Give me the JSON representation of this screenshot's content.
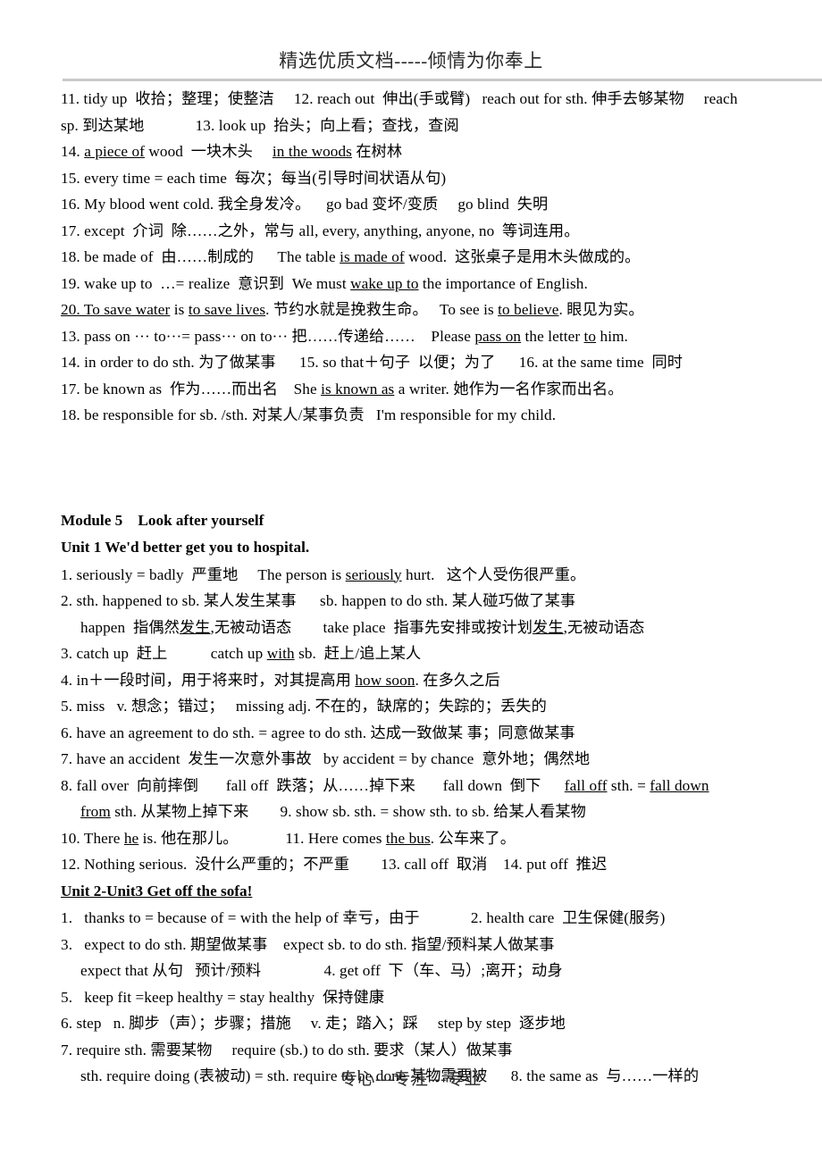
{
  "document": {
    "header_text": "精选优质文档-----倾情为你奉上",
    "footer_text": "专心---专注---专业"
  },
  "section_one": {
    "lines": [
      "11. tidy up  收拾；整理；使整洁     12. reach out  伸出(手或臂)   reach out for sth. 伸手去够某物     reach",
      "sp. 到达某地             13. look up  抬头；向上看；查找，查阅"
    ],
    "line14": {
      "prefix": "14. ",
      "u1": "a piece of",
      "mid1": " wood  一块木头     ",
      "u2": "in the woods",
      "suffix": " 在树林"
    },
    "line15": "15. every time = each time  每次；每当(引导时间状语从句)",
    "line16": "16. My blood went cold. 我全身发冷。    go bad 变坏/变质     go blind  失明",
    "line17": "17. except  介词  除……之外，常与 all, every, anything, anyone, no  等词连用。",
    "line18": {
      "prefix": "18. be made of  由……制成的      The table ",
      "u1": "is made of",
      "suffix": " wood.  这张桌子是用木头做成的。"
    },
    "line19": {
      "prefix": "19. wake up to  …= realize  意识到  We must ",
      "u1": "wake up to",
      "suffix": " the importance of English."
    },
    "line20": {
      "u1": "20. To save water",
      "mid1": " is ",
      "u2": "to save lives",
      "mid2": ". 节约水就是挽救生命。   To see is ",
      "u3": "to believe",
      "suffix": ". 眼见为实。"
    },
    "line13b": {
      "prefix": "13. pass on ··· to···= pass··· on to··· 把……传递给……    Please ",
      "u1": "pass on",
      "mid1": " the letter ",
      "u2": "to",
      "suffix": " him."
    },
    "line14b": "14. in order to do sth. 为了做某事      15. so that＋句子  以便；为了      16. at the same time  同时",
    "line17b": {
      "prefix": "17. be known as  作为……而出名    She ",
      "u1": "is known as",
      "suffix": " a writer. 她作为一名作家而出名。"
    },
    "line18b": "18. be responsible for sb. /sth. 对某人/某事负责   I'm responsible for my child."
  },
  "module5": {
    "title": "Module 5    Look after yourself",
    "unit1_title": "Unit 1 We'd better get you to hospital.",
    "line1": {
      "prefix": "1. seriously = badly  严重地     The person is ",
      "u1": "seriously",
      "suffix": " hurt.   这个人受伤很严重。"
    },
    "line2": "2. sth. happened to sb. 某人发生某事      sb. happen to do sth. 某人碰巧做了某事",
    "line2b": {
      "prefix": "happen  指偶然",
      "u1": "发生",
      "mid1": ",无被动语态        take place  指事先安排或按计划",
      "u2": "发生",
      "suffix": ",无被动语态"
    },
    "line3": {
      "prefix": "3. catch up  赶上           catch up ",
      "u1": "with",
      "suffix": " sb.  赶上/追上某人"
    },
    "line4": {
      "prefix": "4. in＋一段时间，用于将来时，对其提高用 ",
      "u1": "how soon",
      "suffix": ". 在多久之后"
    },
    "line5": "5. miss   v. 想念；错过；   missing adj. 不在的，缺席的；失踪的；丢失的",
    "line6": "6. have an agreement to do sth. = agree to do sth. 达成一致做某 事；同意做某事",
    "line7": "7. have an accident  发生一次意外事故   by accident = by chance  意外地；偶然地",
    "line8": {
      "prefix": "8. fall over  向前摔倒       fall off  跌落；从……掉下来       fall down  倒下      ",
      "u1": "fall off",
      "mid1": " sth. = ",
      "u2": "fall down"
    },
    "line8b": {
      "u1": "from",
      "suffix": " sth. 从某物上掉下来        9. show sb. sth. = show sth. to sb. 给某人看某物"
    },
    "line10": {
      "prefix": "10. There ",
      "u1": "he",
      "mid1": " is. 他在那儿。            11. Here comes ",
      "u2": "the bus",
      "suffix": ". 公车来了。"
    },
    "line12": "12. Nothing serious.  没什么严重的；不严重        13. call off  取消    14. put off  推迟",
    "unit2_title": "Unit 2-Unit3 Get off the sofa!",
    "u2_line1": "1.   thanks to = because of = with the help of 幸亏，由于             2. health care  卫生保健(服务)",
    "u2_line3": "3.   expect to do sth. 期望做某事    expect sb. to do sth. 指望/预料某人做某事",
    "u2_line3b": "expect that 从句   预计/预料                4. get off  下（车、马）;离开；动身",
    "u2_line5": "5.   keep fit =keep healthy = stay healthy  保持健康",
    "u2_line6": "6. step   n. 脚步（声）；步骤；措施     v. 走；踏入；踩     step by step  逐步地",
    "u2_line7": "7. require sth. 需要某物     require (sb.) to do sth. 要求（某人）做某事",
    "u2_line7b": "sth. require doing (表被动) = sth. require to be done 某物需要被      8. the same as  与……一样的"
  }
}
